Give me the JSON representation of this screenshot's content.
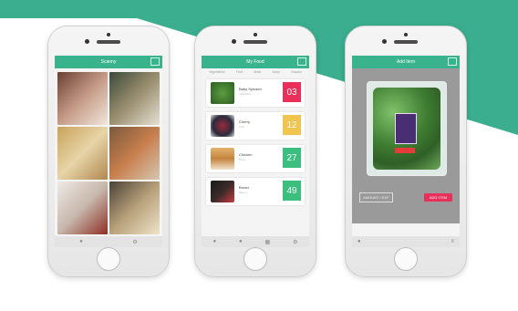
{
  "colors": {
    "accent": "#39b38c",
    "red": "#e8305a",
    "yellow": "#f1c34f",
    "green": "#3cbf7e"
  },
  "phones": [
    {
      "title": "Scanny",
      "tab_icons": [
        "home-icon",
        "gear-icon"
      ]
    },
    {
      "title": "My Food",
      "categories": [
        "Vegetables",
        "Fruit",
        "Meat",
        "Dairy",
        "Snacks"
      ],
      "items": [
        {
          "name": "Baby Spinach",
          "sub": "Vegetable",
          "days": "03",
          "color": "#e8305a"
        },
        {
          "name": "Cherry",
          "sub": "Fruit",
          "days": "12",
          "color": "#f1c34f"
        },
        {
          "name": "Chicken",
          "sub": "Meat",
          "days": "27",
          "color": "#3cbf7e"
        },
        {
          "name": "Bread",
          "sub": "Bakery",
          "days": "49",
          "color": "#3cbf7e"
        }
      ]
    },
    {
      "title": "Add Item",
      "amount_label": "AMOUNT / EXP",
      "add_button": "ADD ITEM"
    }
  ]
}
